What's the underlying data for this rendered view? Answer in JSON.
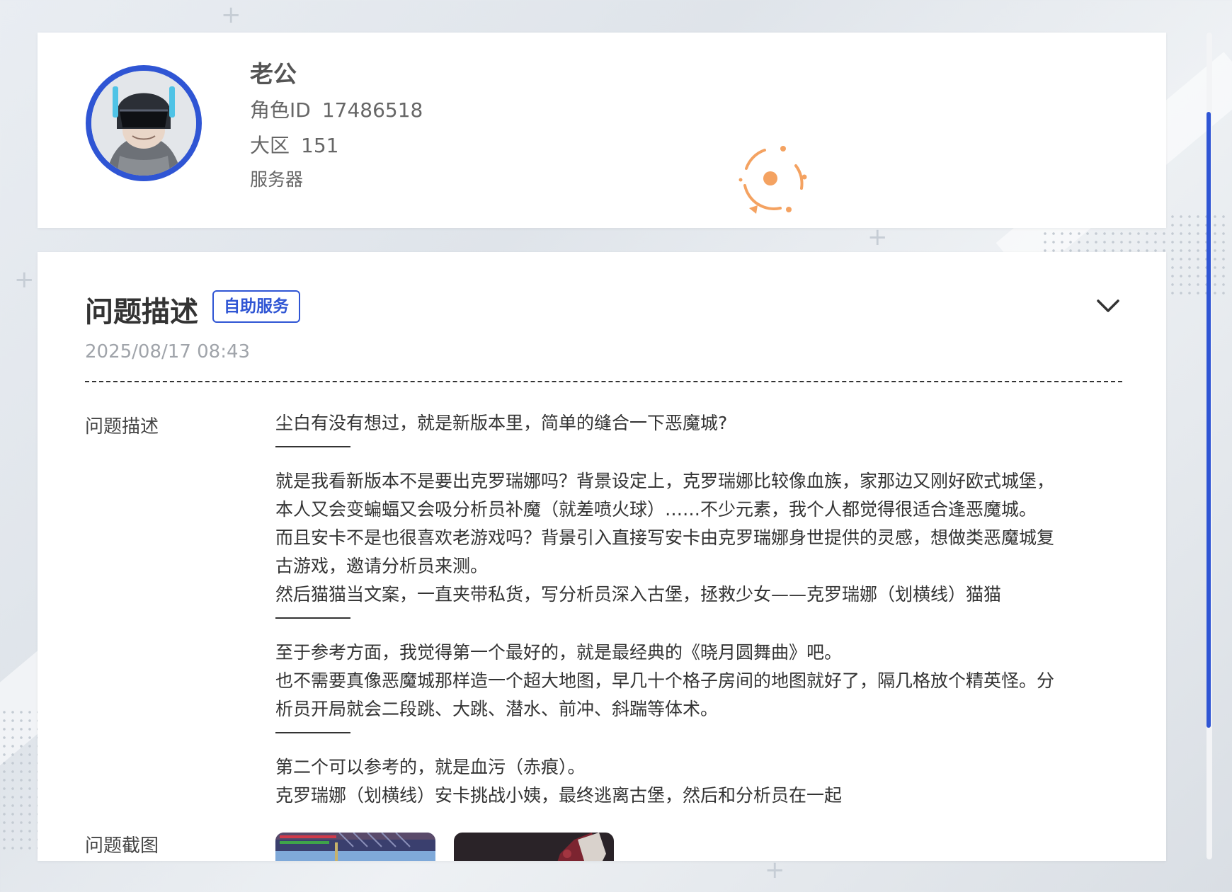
{
  "profile": {
    "name": "老公",
    "role_id_label": "角色ID",
    "role_id": "17486518",
    "region_label": "大区",
    "region": "151",
    "server_label": "服务器"
  },
  "issue": {
    "title": "问题描述",
    "tag": "自助服务",
    "date": "2025/08/17 08:43",
    "desc_label": "问题描述",
    "screenshot_label": "问题截图",
    "description": {
      "line1": "尘白有没有想过，就是新版本里，简单的缝合一下恶魔城?",
      "p2l1": "就是我看新版本不是要出克罗瑞娜吗？背景设定上，克罗瑞娜比较像血族，家那边又刚好欧式城堡，",
      "p2l2": "本人又会变蝙蝠又会吸分析员补魔（就差喷火球）……不少元素，我个人都觉得很适合逢恶魔城。",
      "p2l3": "而且安卡不是也很喜欢老游戏吗？背景引入直接写安卡由克罗瑞娜身世提供的灵感，想做类恶魔城复",
      "p2l4": "古游戏，邀请分析员来测。",
      "p2l5": "然后猫猫当文案，一直夹带私货，写分析员深入古堡，拯救少女——克罗瑞娜（划横线）猫猫",
      "p3l1": "至于参考方面，我觉得第一个最好的，就是最经典的《晓月圆舞曲》吧。",
      "p3l2": "也不需要真像恶魔城那样造一个超大地图，早几十个格子房间的地图就好了，隔几格放个精英怪。分",
      "p3l3": "析员开局就会二段跳、大跳、潜水、前冲、斜踹等体术。",
      "p4l1": "第二个可以参考的，就是血污（赤痕）。",
      "p4l2": "克罗瑞娜（划横线）安卡挑战小姨，最终逃离古堡，然后和分析员在一起"
    }
  },
  "icons": {
    "avatar": "avatar-helmet",
    "spinner": "loading-spinner-icon",
    "collapse": "chevron-down-icon"
  },
  "colors": {
    "accent": "#2f55d4",
    "spinner": "#f4a261"
  }
}
